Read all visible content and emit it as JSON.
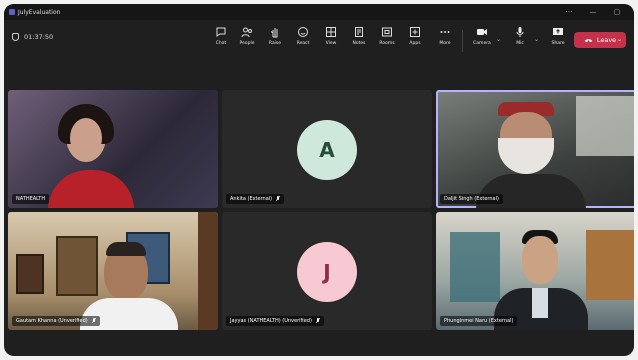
{
  "window": {
    "title": "JulyEvaluation"
  },
  "toolbar": {
    "timer": "01:37:50",
    "buttons": [
      {
        "id": "chat",
        "label": "Chat"
      },
      {
        "id": "people",
        "label": "People"
      },
      {
        "id": "raise",
        "label": "Raise"
      },
      {
        "id": "react",
        "label": "React"
      },
      {
        "id": "view",
        "label": "View"
      },
      {
        "id": "notes",
        "label": "Notes"
      },
      {
        "id": "rooms",
        "label": "Rooms"
      },
      {
        "id": "apps",
        "label": "Apps"
      },
      {
        "id": "more",
        "label": "More"
      },
      {
        "id": "camera",
        "label": "Camera"
      },
      {
        "id": "mic",
        "label": "Mic"
      },
      {
        "id": "share",
        "label": "Share"
      }
    ],
    "leave_label": "Leave"
  },
  "participants": [
    {
      "name": "NATHEALTH",
      "type": "video",
      "tone": "#3d3a52"
    },
    {
      "name": "Ankita (External)",
      "type": "avatar",
      "initial": "A",
      "avatar_bg": "#cfe8dc",
      "avatar_fg": "#264d36"
    },
    {
      "name": "Daljit Singh (External)",
      "type": "video",
      "tone": "#4b4f4d"
    },
    {
      "name": "Gautam Khanna (Unverified)",
      "type": "video",
      "tone": "#6b5a45"
    },
    {
      "name": "Jayyas (NATHEALTH) (Unverified)",
      "type": "avatar",
      "initial": "J",
      "avatar_bg": "#f6c9d3",
      "avatar_fg": "#8a2f46"
    },
    {
      "name": "Phunginmei Naru (External)",
      "type": "video",
      "tone": "#5a6a70"
    }
  ],
  "colors": {
    "leave": "#c4314b",
    "active_border": "#b3b3ff"
  }
}
